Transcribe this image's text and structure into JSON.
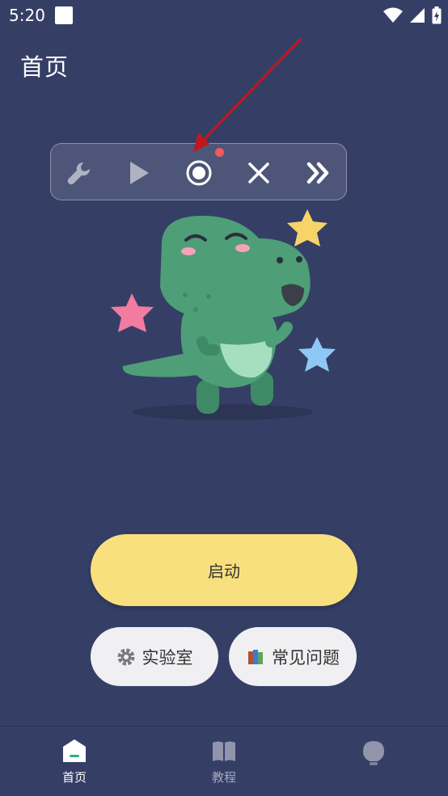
{
  "status_bar": {
    "time": "5:20"
  },
  "header": {
    "title": "首页"
  },
  "toolbar": {
    "buttons": [
      "wrench-icon",
      "play-icon",
      "record-icon",
      "close-icon",
      "double-chevron-right-icon"
    ],
    "recording_indicator_color": "#f05a5a"
  },
  "actions": {
    "start_label": "启动",
    "lab_label": "实验室",
    "faq_label": "常见问题"
  },
  "bottom_nav": {
    "items": [
      {
        "label": "首页",
        "icon": "home-icon",
        "active": true
      },
      {
        "label": "教程",
        "icon": "book-icon",
        "active": false
      },
      {
        "label": "",
        "icon": "bulb-icon",
        "active": false
      }
    ]
  },
  "colors": {
    "background": "#353f66",
    "start_button": "#f9e07e",
    "pill_button": "#f0f0f3",
    "mascot": "#4e9e78"
  }
}
